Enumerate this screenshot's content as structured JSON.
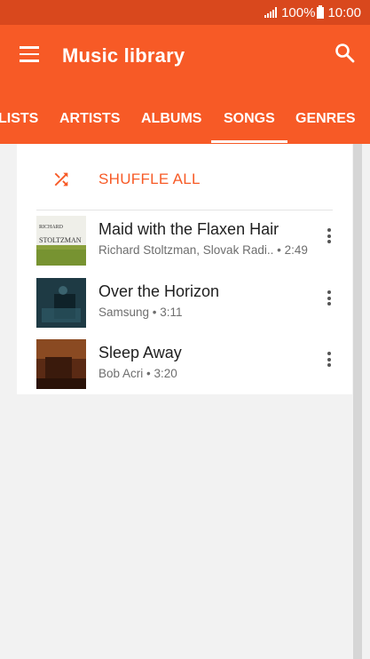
{
  "status": {
    "battery_percent": "100%",
    "time": "10:00",
    "icons": [
      "signal-icon",
      "battery-icon"
    ]
  },
  "header": {
    "title": "Music library",
    "icons": [
      "menu-icon",
      "search-icon"
    ]
  },
  "tabs": [
    {
      "label": "LISTS",
      "active": false
    },
    {
      "label": "ARTISTS",
      "active": false
    },
    {
      "label": "ALBUMS",
      "active": false
    },
    {
      "label": "SONGS",
      "active": true
    },
    {
      "label": "GENRES",
      "active": false
    }
  ],
  "shuffle": {
    "label": "SHUFFLE ALL",
    "icon": "shuffle-icon"
  },
  "songs": [
    {
      "title": "Maid with the Flaxen Hair",
      "artist": "Richard Stoltzman, Slovak Radi..",
      "duration": "• 2:49",
      "art_text": "RICHARD STOLTZMAN"
    },
    {
      "title": "Over the Horizon",
      "subtitle": "Samsung • 3:11"
    },
    {
      "title": "Sleep Away",
      "subtitle": "Bob Acri • 3:20"
    }
  ],
  "colors": {
    "status_bar": "#d9481d",
    "app_bar": "#f75a26",
    "accent": "#f75a26",
    "background": "#f2f2f2"
  }
}
